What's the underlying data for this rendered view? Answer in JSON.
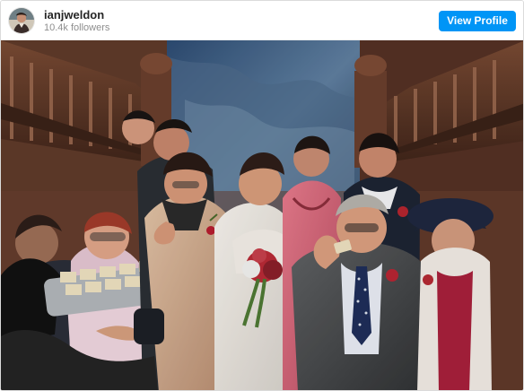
{
  "header": {
    "username": "ianjweldon",
    "followers": "10.4k followers",
    "view_profile_label": "View Profile"
  },
  "avatar": {
    "icon": "profile-avatar-icon"
  },
  "photo": {
    "icon": "wedding-group-photo-icon"
  },
  "colors": {
    "accent": "#0095f6",
    "text_primary": "#262626",
    "text_secondary": "#8e8e8e",
    "border": "#dbdbdb"
  }
}
